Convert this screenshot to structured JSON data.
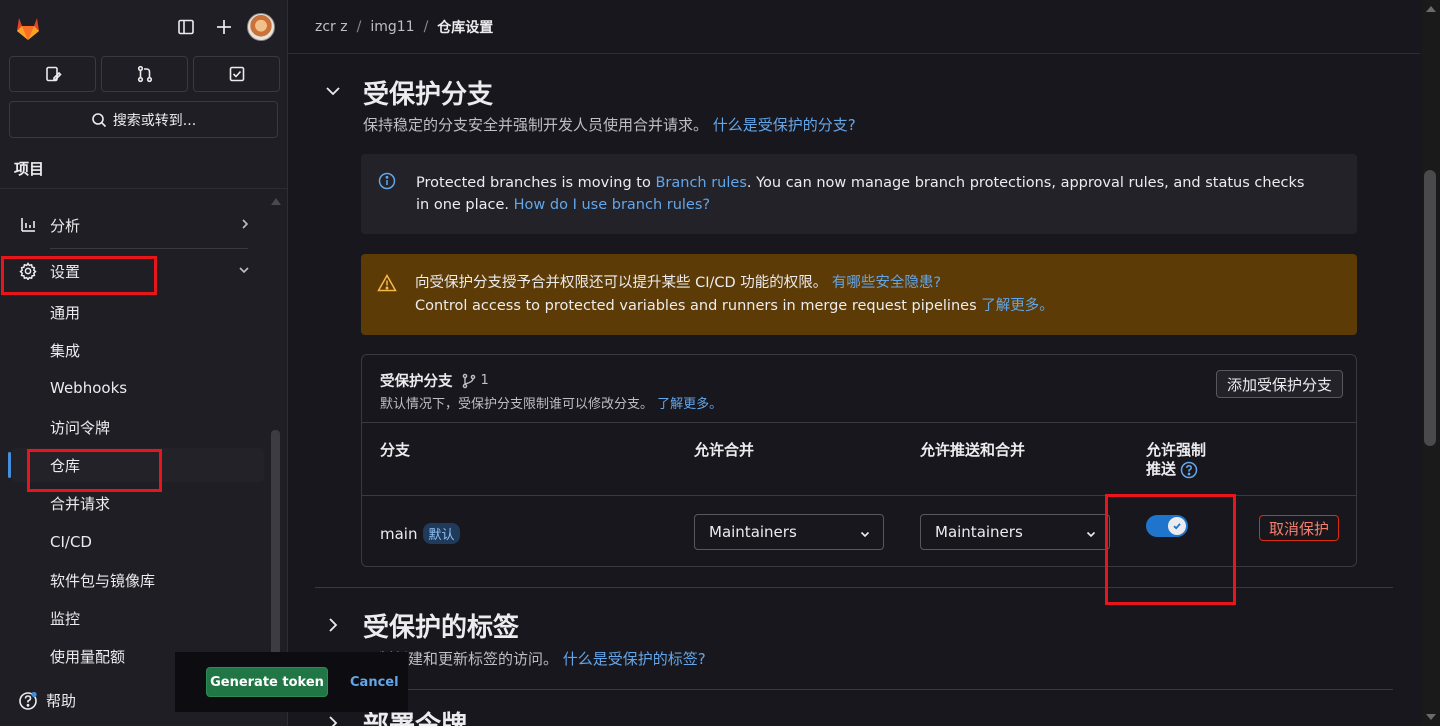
{
  "sidebar": {
    "section_label": "项目",
    "search_label": "搜索或转到...",
    "nav": [
      {
        "label": "分析"
      },
      {
        "label": "设置"
      }
    ],
    "settings_sub": [
      "通用",
      "集成",
      "Webhooks",
      "访问令牌",
      "仓库",
      "合并请求",
      "CI/CD",
      "软件包与镜像库",
      "监控",
      "使用量配额"
    ],
    "help_label": "帮助"
  },
  "token_popover": {
    "generate_label": "Generate token",
    "cancel_label": "Cancel"
  },
  "breadcrumb": {
    "items": [
      "zcr z",
      "img11",
      "仓库设置"
    ],
    "separator": "/"
  },
  "protected_branches": {
    "title": "受保护分支",
    "description": "保持稳定的分支安全并强制开发人员使用合并请求。",
    "description_link": "什么是受保护的分支?",
    "info_alert": {
      "text_before": "Protected branches is moving to ",
      "link1": "Branch rules",
      "text_mid": ". You can now manage branch protections, approval rules, and status checks in one place. ",
      "link2": "How do I use branch rules?"
    },
    "warning_alert": {
      "line1": "向受保护分支授予合并权限还可以提升某些 CI/CD 功能的权限。",
      "line1_link": "有哪些安全隐患?",
      "line2": "Control access to protected variables and runners in merge request pipelines ",
      "line2_link": "了解更多。"
    },
    "card": {
      "title": "受保护分支",
      "count": "1",
      "subtitle": "默认情况下，受保护分支限制谁可以修改分支。",
      "subtitle_link": "了解更多。",
      "add_button": "添加受保护分支",
      "columns": [
        "分支",
        "允许合并",
        "允许推送和合并",
        "允许强制",
        "推送"
      ],
      "rows": [
        {
          "branch": "main",
          "badge": "默认",
          "allowed_to_merge": "Maintainers",
          "allowed_to_push": "Maintainers",
          "force_push": true,
          "unprotect_label": "取消保护"
        }
      ]
    }
  },
  "protected_tags": {
    "title": "受保护的标签",
    "description": "限制创建和更新标签的访问。",
    "description_link": "什么是受保护的标签?"
  },
  "deploy_tokens": {
    "title": "部署令牌"
  },
  "colors": {
    "accent": "#1f75cb",
    "link": "#63a6e9",
    "danger": "#dd2b0e",
    "success": "#217645",
    "warning_bg": "#5c3b06"
  }
}
